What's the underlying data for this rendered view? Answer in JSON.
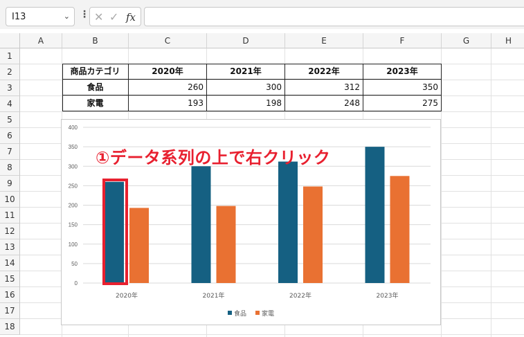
{
  "formula_bar": {
    "name_box": "I13",
    "formula": ""
  },
  "columns": [
    "A",
    "B",
    "C",
    "D",
    "E",
    "F",
    "G",
    "H"
  ],
  "rows": [
    "1",
    "2",
    "3",
    "4",
    "5",
    "6",
    "7",
    "8",
    "9",
    "10",
    "11",
    "12",
    "13",
    "14",
    "15",
    "16",
    "17",
    "18"
  ],
  "table": {
    "header": [
      "商品カテゴリ",
      "2020年",
      "2021年",
      "2022年",
      "2023年"
    ],
    "rows": [
      {
        "label": "食品",
        "values": [
          "260",
          "300",
          "312",
          "350"
        ]
      },
      {
        "label": "家電",
        "values": [
          "193",
          "198",
          "248",
          "275"
        ]
      }
    ]
  },
  "chart_data": {
    "type": "bar",
    "categories": [
      "2020年",
      "2021年",
      "2022年",
      "2023年"
    ],
    "series": [
      {
        "name": "食品",
        "values": [
          260,
          300,
          312,
          350
        ],
        "color": "#156082"
      },
      {
        "name": "家電",
        "values": [
          193,
          198,
          248,
          275
        ],
        "color": "#e97132"
      }
    ],
    "ylim": [
      0,
      400
    ],
    "yticks": [
      "0",
      "50",
      "100",
      "150",
      "200",
      "250",
      "300",
      "350",
      "400"
    ],
    "grid": true,
    "legend_position": "bottom"
  },
  "annotation": {
    "text": "①データ系列の上で右クリック",
    "color": "#e8202f"
  }
}
